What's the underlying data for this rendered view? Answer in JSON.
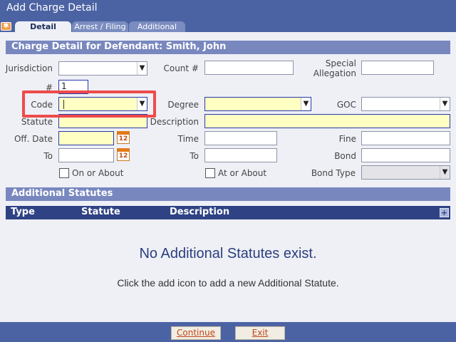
{
  "window": {
    "title": "Add Charge Detail"
  },
  "tabs": [
    {
      "label": "Detail",
      "active": true
    },
    {
      "label": "Arrest / Filing",
      "active": false
    },
    {
      "label": "Additional",
      "active": false
    }
  ],
  "charge_detail": {
    "header": "Charge Detail for Defendant: Smith, John",
    "labels": {
      "jurisdiction": "Jurisdiction",
      "count": "Count #",
      "special_allegation": "Special Allegation",
      "number": "#",
      "code": "Code",
      "degree": "Degree",
      "goc": "GOC",
      "statute": "Statute",
      "description": "Description",
      "off_date": "Off. Date",
      "time": "Time",
      "fine": "Fine",
      "to": "To",
      "to_time": "To",
      "bond": "Bond",
      "on_or_about": "On or About",
      "at_or_about": "At or About",
      "bond_type": "Bond Type"
    },
    "values": {
      "number": "1"
    },
    "calendar_icon_text": "12",
    "select_arrow": "▼"
  },
  "additional_statutes": {
    "header": "Additional Statutes",
    "columns": [
      "Type",
      "Statute",
      "Description"
    ],
    "add_icon_glyph": "+",
    "empty_title": "No Additional Statutes exist.",
    "empty_message": "Click the add icon to add a new Additional Statute."
  },
  "footer": {
    "continue_label": "Continue",
    "exit_label": "Exit"
  },
  "colors": {
    "header_bg": "#4c63a3",
    "section_bg": "#7987bf",
    "table_header_bg": "#2f4284",
    "required_field": "#ffffc4",
    "highlight": "#ee4b4b"
  }
}
